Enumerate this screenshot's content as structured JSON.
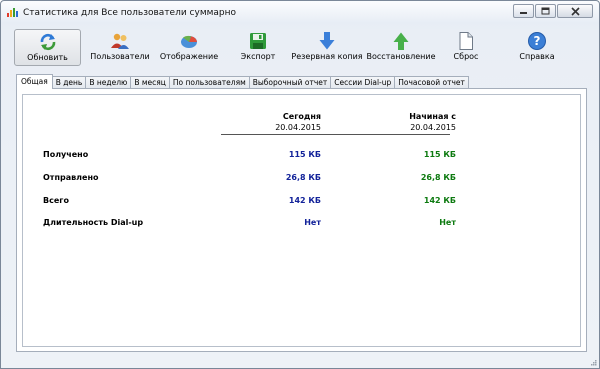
{
  "window": {
    "title": "Статистика для Все пользователи суммарно"
  },
  "toolbar": {
    "buttons": [
      {
        "label": "Обновить",
        "icon": "refresh-icon"
      },
      {
        "label": "Пользователи",
        "icon": "users-icon"
      },
      {
        "label": "Отображение",
        "icon": "display-icon"
      },
      {
        "label": "Экспорт",
        "icon": "save-icon"
      },
      {
        "label": "Резервная копия",
        "icon": "arrow-down-icon"
      },
      {
        "label": "Восстановление",
        "icon": "arrow-up-icon"
      },
      {
        "label": "Сброс",
        "icon": "document-icon"
      },
      {
        "label": "Справка",
        "icon": "help-icon"
      }
    ]
  },
  "tabs": [
    {
      "label": "Общая",
      "active": true
    },
    {
      "label": "В день"
    },
    {
      "label": "В неделю"
    },
    {
      "label": "В месяц"
    },
    {
      "label": "По пользователям"
    },
    {
      "label": "Выборочный отчет"
    },
    {
      "label": "Сессии Dial-up"
    },
    {
      "label": "Почасовой отчет"
    }
  ],
  "table": {
    "columns": [
      {
        "header": "Сегодня",
        "date": "20.04.2015"
      },
      {
        "header": "Начиная с",
        "date": "20.04.2015"
      }
    ],
    "rows": [
      {
        "label": "Получено",
        "today": "115 КБ",
        "since": "115 КБ"
      },
      {
        "label": "Отправлено",
        "today": "26,8 КБ",
        "since": "26,8 КБ"
      },
      {
        "label": "Всего",
        "today": "142 КБ",
        "since": "142 КБ"
      },
      {
        "label": "Длительность Dial-up",
        "today": "Нет",
        "since": "Нет"
      }
    ]
  },
  "colors": {
    "today_value": "#13239a",
    "since_value": "#0d7a10"
  }
}
